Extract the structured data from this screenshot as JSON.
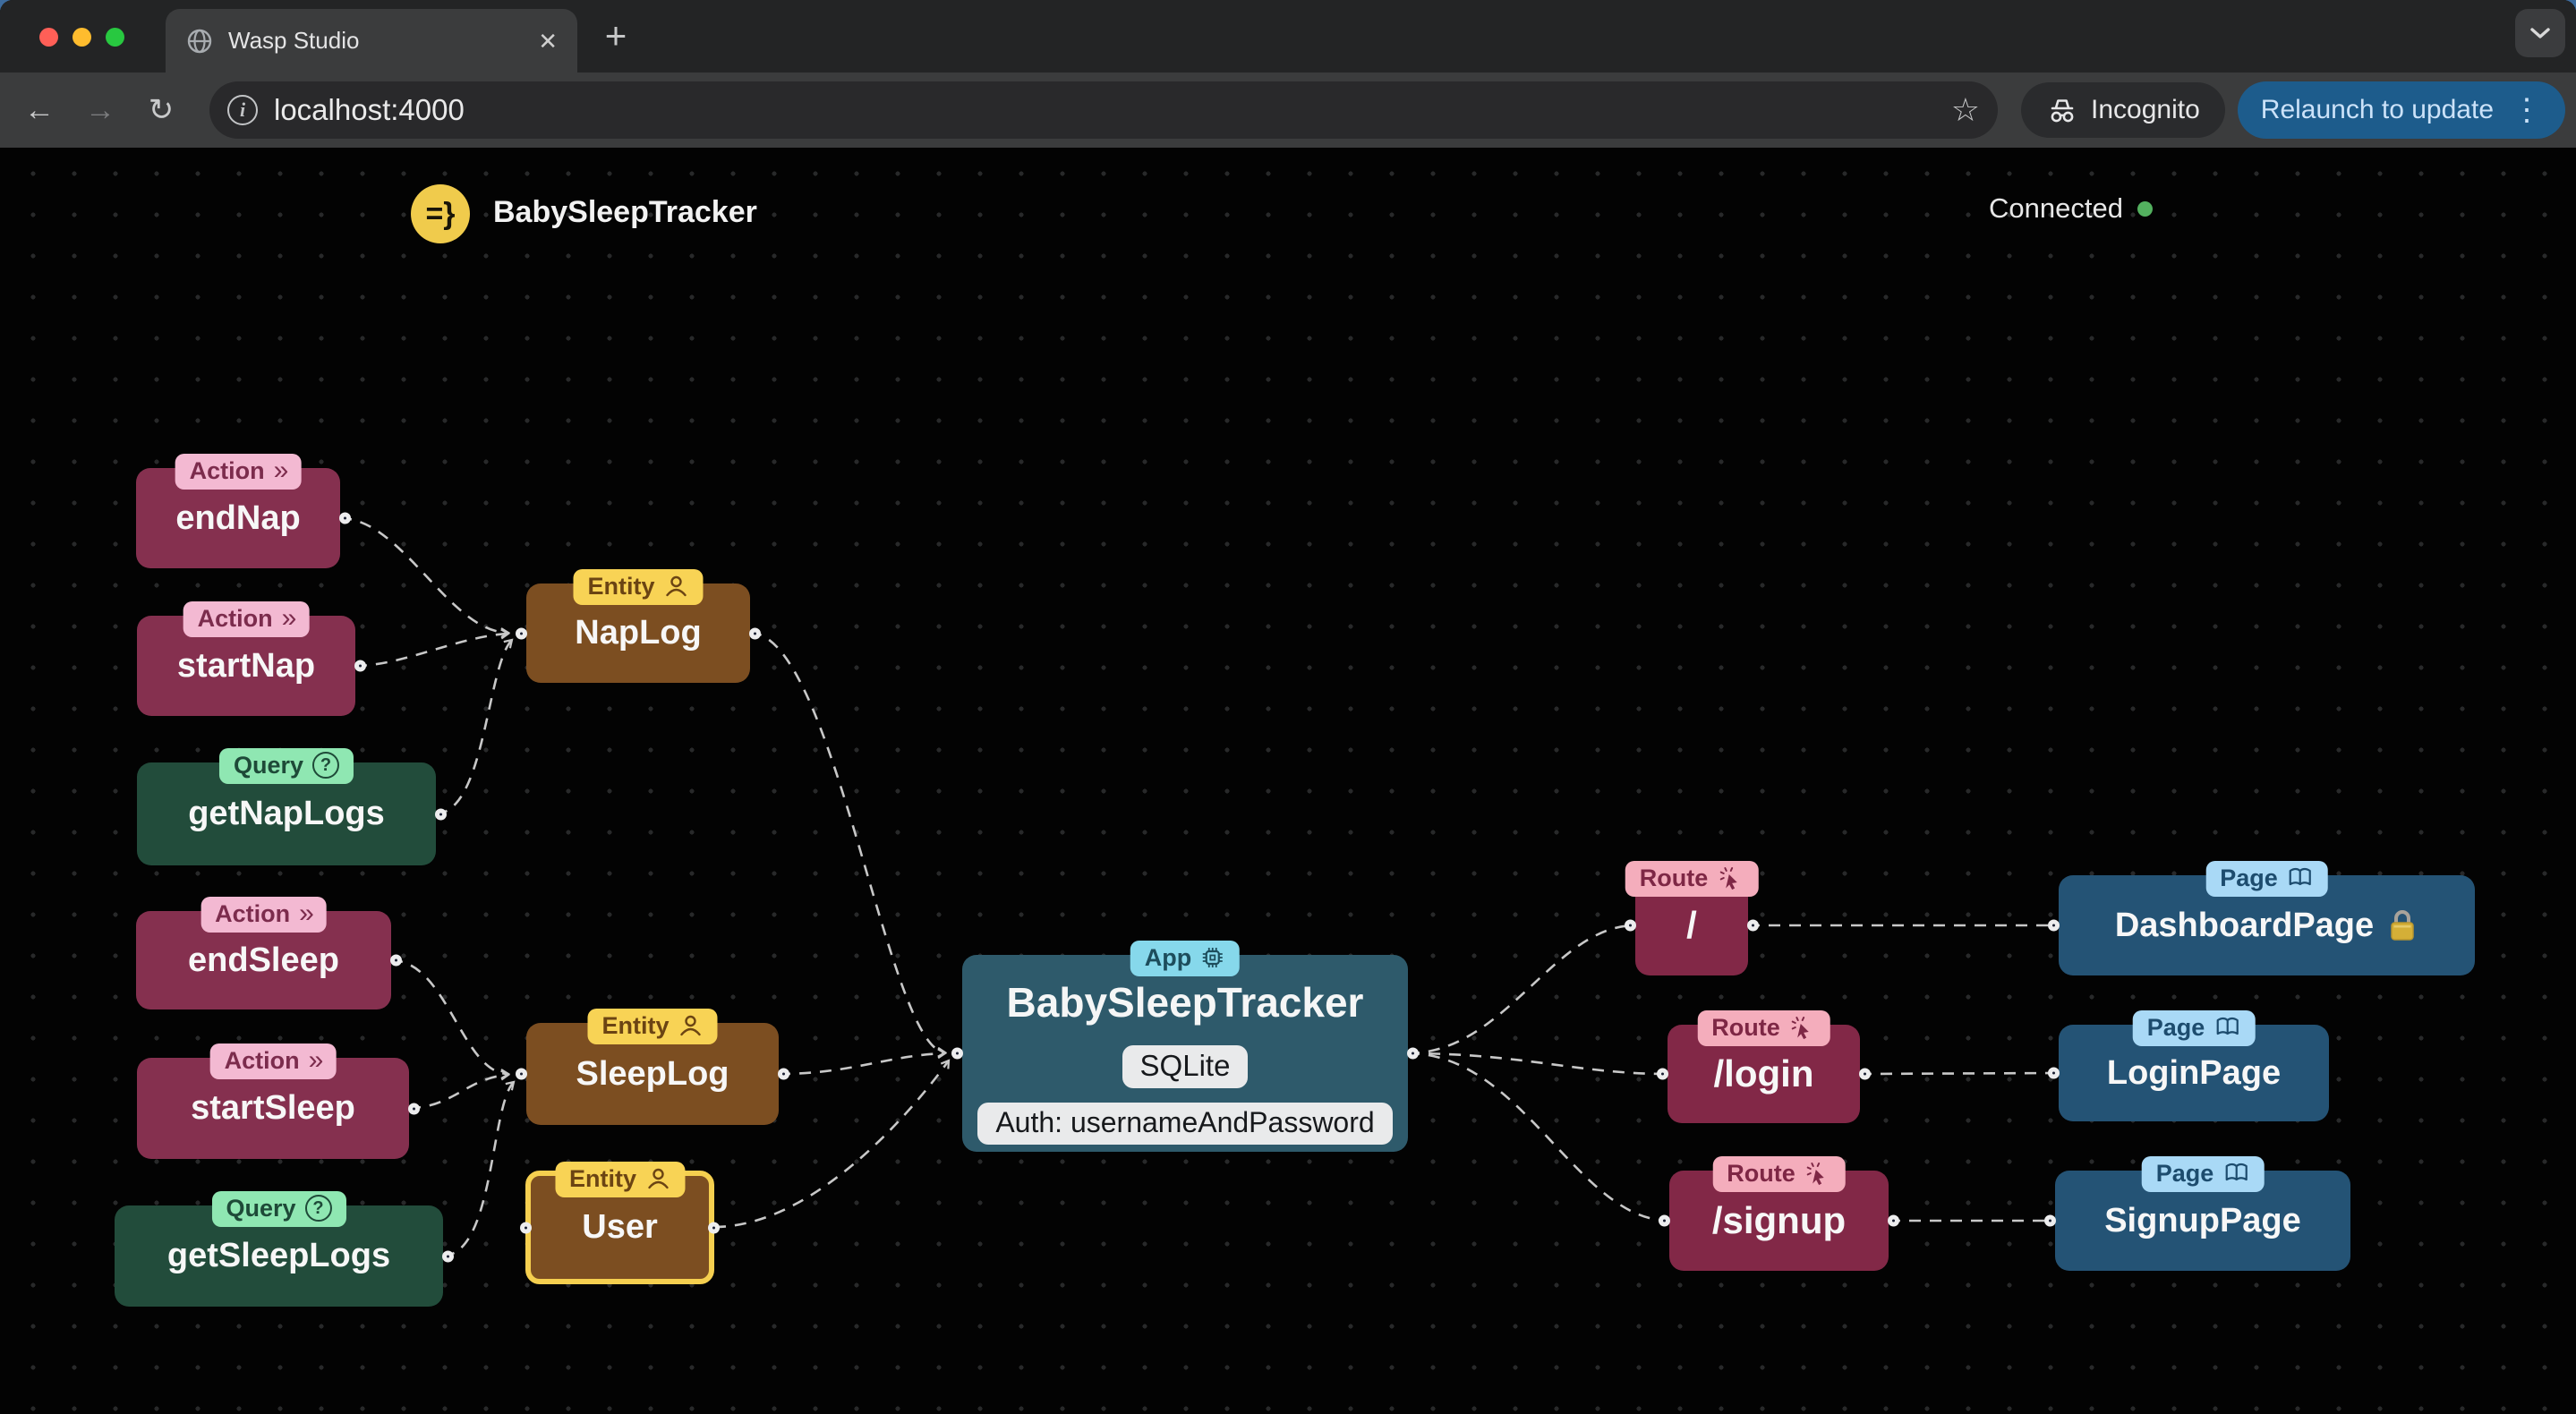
{
  "browser": {
    "tab_title": "Wasp Studio",
    "close_tab_glyph": "✕",
    "new_tab_glyph": "+",
    "back_glyph": "←",
    "forward_glyph": "→",
    "reload_glyph": "↻",
    "info_glyph": "i",
    "url": "localhost:4000",
    "star_glyph": "☆",
    "incognito_label": "Incognito",
    "relaunch_label": "Relaunch to update",
    "kebab_glyph": "⋮"
  },
  "header": {
    "logo_glyph": "=}",
    "app_title": "BabySleepTracker",
    "status_label": "Connected",
    "status_color": "#53B15F"
  },
  "graph": {
    "actions": [
      {
        "badge": "Action",
        "label": "endNap"
      },
      {
        "badge": "Action",
        "label": "startNap"
      },
      {
        "badge": "Action",
        "label": "endSleep"
      },
      {
        "badge": "Action",
        "label": "startSleep"
      }
    ],
    "queries": [
      {
        "badge": "Query",
        "label": "getNapLogs"
      },
      {
        "badge": "Query",
        "label": "getSleepLogs"
      }
    ],
    "entities": [
      {
        "badge": "Entity",
        "label": "NapLog"
      },
      {
        "badge": "Entity",
        "label": "SleepLog"
      },
      {
        "badge": "Entity",
        "label": "User",
        "highlighted": true
      }
    ],
    "app": {
      "badge": "App",
      "label": "BabySleepTracker",
      "database": "SQLite",
      "auth": "Auth: usernameAndPassword"
    },
    "routes": [
      {
        "badge": "Route",
        "label": "/"
      },
      {
        "badge": "Route",
        "label": "/login"
      },
      {
        "badge": "Route",
        "label": "/signup"
      }
    ],
    "pages": [
      {
        "badge": "Page",
        "label": "DashboardPage",
        "locked": true
      },
      {
        "badge": "Page",
        "label": "LoginPage"
      },
      {
        "badge": "Page",
        "label": "SignupPage"
      }
    ],
    "edges": [
      [
        "endNap",
        "NapLog"
      ],
      [
        "startNap",
        "NapLog"
      ],
      [
        "getNapLogs",
        "NapLog"
      ],
      [
        "endSleep",
        "SleepLog"
      ],
      [
        "startSleep",
        "SleepLog"
      ],
      [
        "getSleepLogs",
        "SleepLog"
      ],
      [
        "NapLog",
        "BabySleepTracker"
      ],
      [
        "SleepLog",
        "BabySleepTracker"
      ],
      [
        "User",
        "BabySleepTracker"
      ],
      [
        "BabySleepTracker",
        "/"
      ],
      [
        "BabySleepTracker",
        "/login"
      ],
      [
        "BabySleepTracker",
        "/signup"
      ],
      [
        "/",
        "DashboardPage"
      ],
      [
        "/login",
        "LoginPage"
      ],
      [
        "/signup",
        "SignupPage"
      ]
    ]
  },
  "colors": {
    "action": "#85304F",
    "action_badge": "#F3B9D2",
    "query": "#224C3B",
    "query_badge": "#8FE7B2",
    "entity": "#7C4E21",
    "entity_badge": "#F8D355",
    "app": "#2E5A6B",
    "app_badge": "#86D8EB",
    "route": "#822847",
    "route_badge": "#F4ADBC",
    "page": "#245375",
    "page_badge": "#A9D9F6",
    "edge": "#C8C8C8",
    "highlight_border": "#F5CF4F",
    "relaunch_button": "#1D5C8C"
  }
}
